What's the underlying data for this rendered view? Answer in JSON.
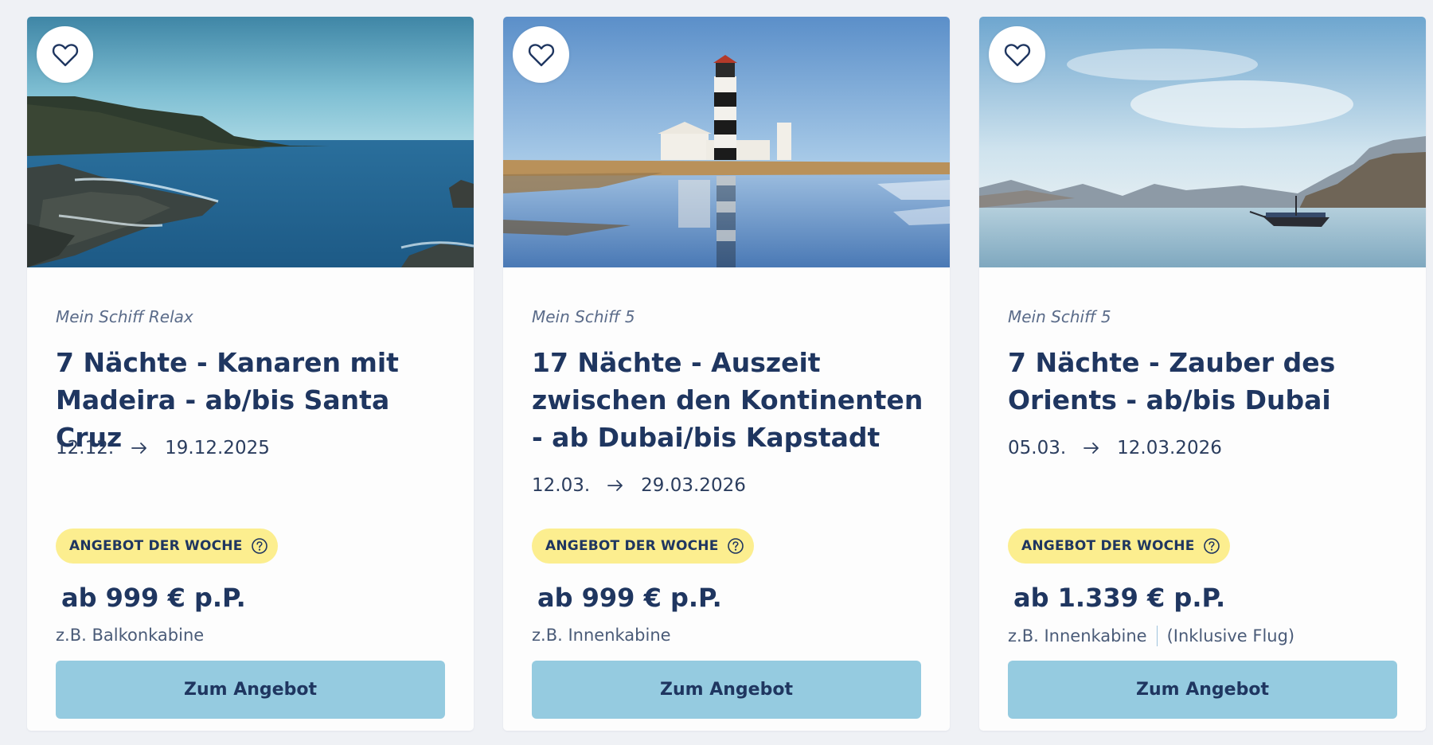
{
  "colors": {
    "page_bg": "#eff1f5",
    "card_bg": "#fdfdfd",
    "text_primary": "#1f3660",
    "badge_bg": "#fcee8f",
    "button_bg": "#95cbe0"
  },
  "cards": [
    {
      "image": "coastline-sea",
      "favorite_icon": "heart-outline-icon",
      "ship": "Mein Schiff Relax",
      "title": "7 Nächte - Kanaren mit Madeira - ab/bis Santa Cruz",
      "date_from": "12.12.",
      "date_to": "19.12.2025",
      "badge": "ANGEBOT DER WOCHE",
      "price": "ab 999 € p.P.",
      "cabin": "z.B. Balkonkabine",
      "extra": "",
      "button": "Zum Angebot"
    },
    {
      "image": "lighthouse-beach",
      "favorite_icon": "heart-outline-icon",
      "ship": "Mein Schiff 5",
      "title": "17 Nächte - Auszeit zwischen den Kontinenten - ab Dubai/bis Kapstadt",
      "date_from": "12.03.",
      "date_to": "29.03.2026",
      "badge": "ANGEBOT DER WOCHE",
      "price": "ab 999 € p.P.",
      "cabin": "z.B. Innenkabine",
      "extra": "",
      "button": "Zum Angebot"
    },
    {
      "image": "dhow-boat-mountains",
      "favorite_icon": "heart-outline-icon",
      "ship": "Mein Schiff 5",
      "title": "7 Nächte - Zauber des Orients - ab/bis Dubai",
      "date_from": "05.03.",
      "date_to": "12.03.2026",
      "badge": "ANGEBOT DER WOCHE",
      "price": "ab 1.339 € p.P.",
      "cabin": "z.B. Innenkabine",
      "extra": "(Inklusive Flug)",
      "button": "Zum Angebot"
    }
  ]
}
